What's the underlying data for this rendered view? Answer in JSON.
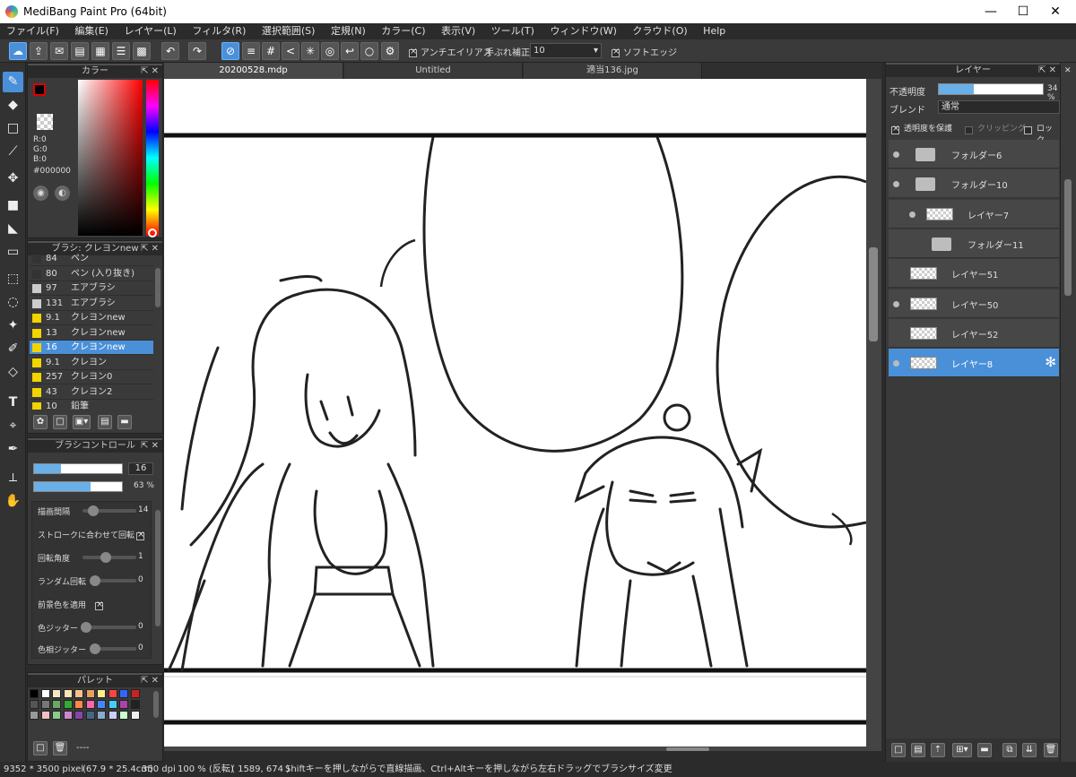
{
  "window": {
    "title": "MediBang Paint Pro (64bit)",
    "minimize": "—",
    "maximize": "☐",
    "close": "✕"
  },
  "menu": [
    "ファイル(F)",
    "編集(E)",
    "レイヤー(L)",
    "フィルタ(R)",
    "選択範囲(S)",
    "定規(N)",
    "カラー(C)",
    "表示(V)",
    "ツール(T)",
    "ウィンドウ(W)",
    "クラウド(O)",
    "Help"
  ],
  "toolbar": {
    "antialias_label": "アンチエイリアス",
    "stabilizer_label": "手ぶれ補正",
    "stabilizer_value": "10",
    "softedge_label": "ソフトエッジ"
  },
  "color_panel": {
    "title": "カラー",
    "r": "R:0",
    "g": "G:0",
    "b": "B:0",
    "hex": "#000000",
    "fg_color": "#000000"
  },
  "brush_panel": {
    "title": "ブラシ: クレヨンnew",
    "items": [
      {
        "size": "84",
        "name": "ペン",
        "color": "#333333"
      },
      {
        "size": "80",
        "name": "ペン (入り抜き)",
        "color": "#333333"
      },
      {
        "size": "97",
        "name": "エアブラシ",
        "color": "#cccccc"
      },
      {
        "size": "131",
        "name": "エアブラシ",
        "color": "#cccccc"
      },
      {
        "size": "9.1",
        "name": "クレヨンnew",
        "color": "#f2d400"
      },
      {
        "size": "13",
        "name": "クレヨンnew",
        "color": "#f2d400"
      },
      {
        "size": "16",
        "name": "クレヨンnew",
        "color": "#f2d400"
      },
      {
        "size": "9.1",
        "name": "クレヨン",
        "color": "#f2d400"
      },
      {
        "size": "257",
        "name": "クレヨン0",
        "color": "#f2d400"
      },
      {
        "size": "43",
        "name": "クレヨン2",
        "color": "#f2d400"
      },
      {
        "size": "10",
        "name": "鉛筆",
        "color": "#f2d400"
      }
    ]
  },
  "brush_control": {
    "title": "ブラシコントロール",
    "size_value": "16",
    "opacity_value": "63 %",
    "spacing_label": "描画間隔",
    "spacing_value": "14",
    "rotate_stroke_label": "ストロークに合わせて回転",
    "angle_label": "回転角度",
    "angle_value": "1",
    "random_rot_label": "ランダム回転",
    "random_rot_value": "0",
    "fg_label": "前景色を適用",
    "jitter_label": "色ジッター",
    "jitter_value": "0",
    "hue_jitter_label": "色相ジッター",
    "hue_jitter_value": "0"
  },
  "palette_panel": {
    "title": "パレット",
    "footer_text": "----",
    "colors": [
      "#000000",
      "#ffffff",
      "#f5e6c8",
      "#ffe4b5",
      "#f4c28a",
      "#e8a060",
      "#ffee88",
      "#ff4444",
      "#3366ff",
      "#cc2222",
      "#555555",
      "#777777",
      "#66aa66",
      "#33aa33",
      "#ff8844",
      "#ff66aa",
      "#4488ff",
      "#44ccff",
      "#aa44aa",
      "#222222",
      "#999999",
      "#f0c0c0",
      "#88cc88",
      "#cc88cc",
      "#8844aa",
      "#446688",
      "#88aacc",
      "#ccccff",
      "#ccffcc",
      "#eeeeee"
    ]
  },
  "tabs": [
    {
      "label": "20200528.mdp"
    },
    {
      "label": "Untitled"
    },
    {
      "label": "適当136.jpg"
    }
  ],
  "layer_panel": {
    "title": "レイヤー",
    "opacity_label": "不透明度",
    "opacity_value": "34 %",
    "opacity_fraction": 0.34,
    "blend_label": "ブレンド",
    "blend_value": "通常",
    "protect_label": "透明度を保護",
    "clip_label": "クリッピング",
    "lock_label": "ロック",
    "layers": [
      {
        "name": "フォルダー6",
        "type": "folder",
        "visible": true,
        "indent": 0
      },
      {
        "name": "フォルダー10",
        "type": "folder",
        "visible": true,
        "indent": 0
      },
      {
        "name": "レイヤー7",
        "type": "layer",
        "visible": true,
        "indent": 1
      },
      {
        "name": "フォルダー11",
        "type": "folder",
        "visible": false,
        "indent": 1
      },
      {
        "name": "レイヤー51",
        "type": "layer",
        "visible": false,
        "indent": 0
      },
      {
        "name": "レイヤー50",
        "type": "layer",
        "visible": true,
        "indent": 0
      },
      {
        "name": "レイヤー52",
        "type": "layer",
        "visible": false,
        "indent": 0
      },
      {
        "name": "レイヤー8",
        "type": "layer",
        "visible": true,
        "indent": 0
      }
    ]
  },
  "status": {
    "size": "9352 * 3500 pixel",
    "physical": "(67.9 * 25.4cm)",
    "dpi": "350 dpi",
    "zoom": "100 % (反転)",
    "coords": "( 1589, 674 )",
    "hint": "Shiftキーを押しながらで直線描画、Ctrl+Altキーを押しながら左右ドラッグでブラシサイズ変更"
  }
}
